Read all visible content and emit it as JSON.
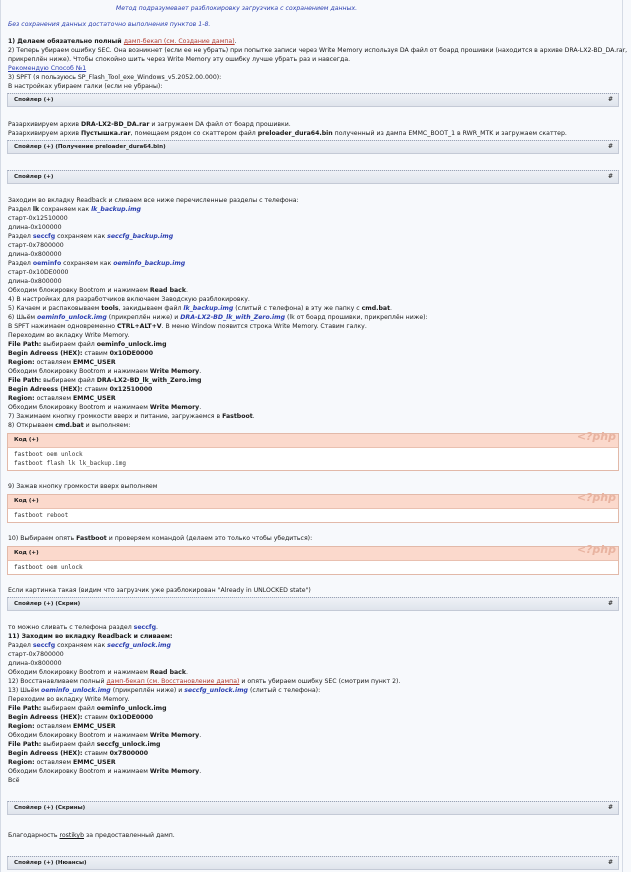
{
  "header": {
    "method_line": "Метод подразумевает разблокировку загрузчика с сохранением данных.",
    "note": "Без сохранения данных достаточно выполнения пунктов 1-8."
  },
  "steps_top": {
    "s1_pre": "1) Делаем обязательно полный ",
    "s1_link": "дамп-бекап (см. Создание дампа)",
    "s1_post": ".",
    "s2_line1": "2) Теперь убираем ошибку SEC. Она возникнет (если ее не убрать) при попытке записи через Write Memory используя DA файл от боард прошивки (находится в архиве DRA-LX2-BD_DA.rar,",
    "s2_line2": "прикреплён ниже). Чтобы спокойно шить через Write Memory эту ошибку лучше убрать раз и навсегда.",
    "recommend": "Рекомендую Способ №1",
    "s3_line": "3) SPFT (я пользуюсь SP_Flash_Tool_exe_Windows_v5.2052.00.000):",
    "s3_sub": "В настройках убираем галки (если не убраны):"
  },
  "spoiler_label": "Спойлер (+)",
  "hash": "#",
  "unpack": {
    "line1_pre": "Разархивируем архив ",
    "line1_bold": "DRA-LX2-BD_DA.rar",
    "line1_post": " и загружаем DA файл от боард прошивки.",
    "line2_pre": "Разархивируем архив ",
    "line2_bold": "Пустышка.rar",
    "line2_mid": ", помещаем рядом со скаттером файл ",
    "line2_bold2": "preloader_dura64.bin",
    "line2_post": " полученный из дампа EMMC_BOOT_1 в RWR_MTK и загружаем скаттер."
  },
  "spoiler_preloader": "Спойлер (+) (Получение preloader_dura64.bin)",
  "readback": {
    "intro": "Заходим во вкладку Readback и сливаем все ниже перечисленные разделы с телефона:",
    "lk_pre": "Раздел ",
    "lk_name": "lk",
    "lk_mid": " сохраняем как ",
    "lk_file": "lk_backup.img",
    "lk_start": "старт-0x12510000",
    "lk_len": "длина-0x100000",
    "sec_pre": "Раздел ",
    "sec_name": "seccfg",
    "sec_mid": " сохраняем как ",
    "sec_file": "seccfg_backup.img",
    "sec_start": "старт-0x7800000",
    "sec_len": "длина-0x800000",
    "oem_pre": "Раздел ",
    "oem_name": "oeminfo",
    "oem_mid": " сохраняем как ",
    "oem_file": "oeminfo_backup.img",
    "oem_start": "старт-0x10DE0000",
    "oem_len": "длина-0x800000",
    "bypass_pre": "Обходим блокировку Bootrom и нажимаем ",
    "bypass_bold": "Read back",
    "s4": "4) В настройках для разработчиков включаем Заводскую разблокировку.",
    "s5_pre": "5) Качаем и распаковываем ",
    "s5_tools": "tools",
    "s5_mid": ", закидываем файл ",
    "s5_file": "lk_backup.img",
    "s5_mid2": " (слитый с телефона) в эту же папку с ",
    "s5_bat": "cmd.bat",
    "s6_pre": "6) Шьём ",
    "s6_f1": "oeminfo_unlock.img",
    "s6_mid": " (прикреплён ниже) и ",
    "s6_f2": "DRA-LX2-BD_lk_with_Zero.img",
    "s6_post": " (lk от боард прошивки, прикреплён ниже):",
    "s6_line2_pre": "В SPFT нажимаем одновременно ",
    "s6_keys": "CTRL+ALT+V",
    "s6_line2_post": ". В меню Window появится строка Write Memory. Ставим галку.",
    "s6_line3": "Переходим во вкладку Write Memory.",
    "fp_label": "File Path:",
    "fp1_text": " выбираем файл ",
    "fp1_file": "oeminfo_unlock.img",
    "ba_label": "Begin Adreess (HEX):",
    "ba1_text": " ставим ",
    "ba1_val": "0x10DE0000",
    "rg_label": "Region:",
    "rg_text": " оставляем ",
    "rg_val": "EMMC_USER",
    "bypass2_pre": "Обходим блокировку Bootrom и нажимаем ",
    "bypass2_bold": "Write Memory",
    "fp2_file": "DRA-LX2-BD_lk_with_Zero.img",
    "ba2_val": "0x12510000",
    "s7_pre": "7) Зажимаем кнопку громкости вверх и питание, загружаемся в ",
    "s7_bold": "Fastboot",
    "s8_pre": "8) Открываем ",
    "s8_bold": "cmd.bat",
    "s8_post": " и выполняем:"
  },
  "code_label": "Код (+)",
  "php_mark": "<?php",
  "code1": [
    "fastboot oem unlock",
    "fastboot flash lk lk_backup.img"
  ],
  "s9": "9) Зажав кнопку громкости вверх выполняем",
  "code2": [
    "fastboot reboot"
  ],
  "s10_pre": "10) Выбираем опять ",
  "s10_bold": "Fastboot",
  "s10_post": " и проверяем командой (делаем это только чтобы убедиться):",
  "code3": [
    "fastboot oem unlock"
  ],
  "after_code": "Если картинка такая (видим что загрузчик уже разблокирован \"Already in UNLOCKED state\")",
  "spoiler_screen": "Спойлер (+) (Скрин)",
  "restore": {
    "l1_pre": "то можно сливать с телефона раздел ",
    "l1_name": "seccfg",
    "s11": "11) Заходим во вкладку Readback и сливаем:",
    "sec_pre": "Раздел ",
    "sec_name": "seccfg",
    "sec_mid": " сохраняем как ",
    "sec_file": "seccfg_unlock.img",
    "start": "старт-0x7800000",
    "len": "длина-0x800000",
    "bypass_pre": "Обходим блокировку Bootrom и нажимаем ",
    "bypass_bold": "Read back",
    "s12_pre": "12) Восстанавливаем полный ",
    "s12_link": "дамп-бекап (см. Восстановление дампа)",
    "s12_post": " и опять убираем ошибку SEC (смотрим пункт 2).",
    "s13_pre": "13) Шьём ",
    "s13_f1": "oeminfo_unlock.img",
    "s13_mid": " (прикреплён ниже) и ",
    "s13_f2": "seccfg_unlock.img",
    "s13_post": " (слитый с телефона):",
    "goto": "Переходим во вкладку Write Memory.",
    "fp1": "oeminfo_unlock.img",
    "ba1": "0x10DE0000",
    "fp2": "seccfg_unlock.img",
    "ba2": "0x7800000",
    "all": "Всё"
  },
  "spoiler_screens": "Спойлер (+) (Скрины)",
  "thanks_pre": "Благодарность ",
  "thanks_user": "rostikyb",
  "thanks_post": " за предоставленный дамп.",
  "spoiler_nuances": "Спойлер (+) (Нюансы)"
}
